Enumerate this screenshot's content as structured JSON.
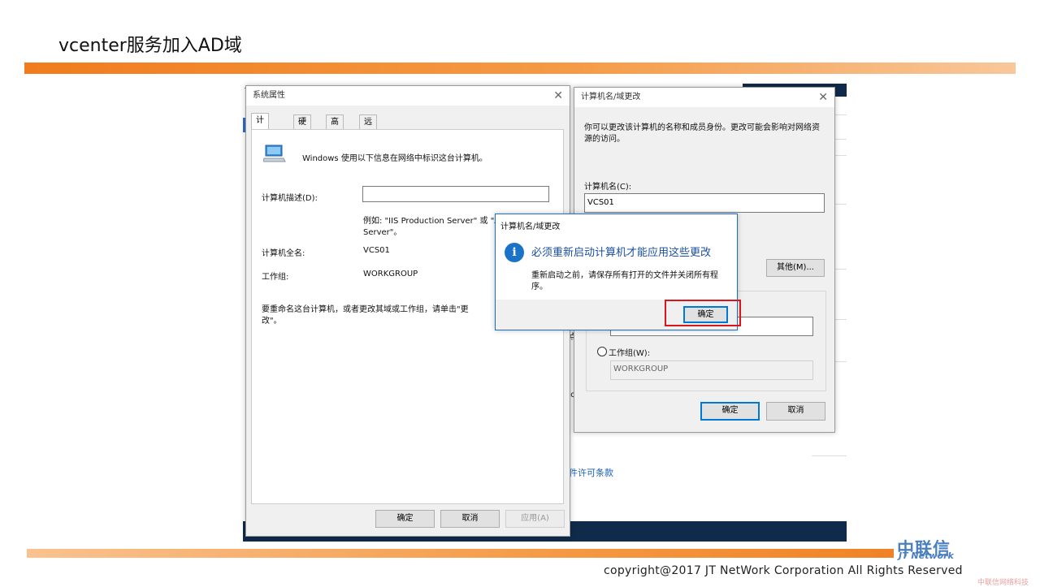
{
  "slide": {
    "title": "vcenter服务加入AD域",
    "logo_cn": "中联信",
    "logo_en": "JT Network",
    "copyright": "copyright@2017  JT NetWork Corporation All Rights Reserved",
    "watermark": "中联信网络科技",
    "accent_color": "#f07c1e",
    "highlight_color": "#d8161b"
  },
  "background": {
    "license_link": "件许可条款",
    "partial_text_1": "点",
    "partial_text_2": ".c",
    "partial_text_3": "T"
  },
  "system_properties": {
    "title": "系统属性",
    "tabs": [
      "计算机名",
      "硬件",
      "高级",
      "远程"
    ],
    "description": "Windows 使用以下信息在网络中标识这台计算机。",
    "computer_desc_label": "计算机描述(D):",
    "computer_desc_value": "",
    "example_line1": "例如: \"IIS Production Server\" 或 \"Accounting",
    "example_line2": "Server\"。",
    "full_name_label": "计算机全名:",
    "full_name_value": "VCS01",
    "workgroup_label": "工作组:",
    "workgroup_value": "WORKGROUP",
    "rename_line1": "要重命名这台计算机，或者更改其域或工作组，请单击\"更",
    "rename_line2": "改\"。",
    "ok": "确定",
    "cancel": "取消",
    "apply": "应用(A)"
  },
  "computer_name_dialog": {
    "title": "计算机名/域更改",
    "intro_line1": "你可以更改该计算机的名称和成员身份。更改可能会影响对网络资",
    "intro_line2": "源的访问。",
    "name_label": "计算机名(C):",
    "name_value": "VCS01",
    "more_button": "其他(M)...",
    "domain_value": "",
    "workgroup_radio": "工作组(W):",
    "workgroup_value": "WORKGROUP",
    "ok": "确定",
    "cancel": "取消"
  },
  "restart_dialog": {
    "title": "计算机名/域更改",
    "icon": "info-icon",
    "heading": "必须重新启动计算机才能应用这些更改",
    "message_line1": "重新启动之前，请保存所有打开的文件并关闭所有程",
    "message_line2": "序。",
    "ok": "确定"
  }
}
